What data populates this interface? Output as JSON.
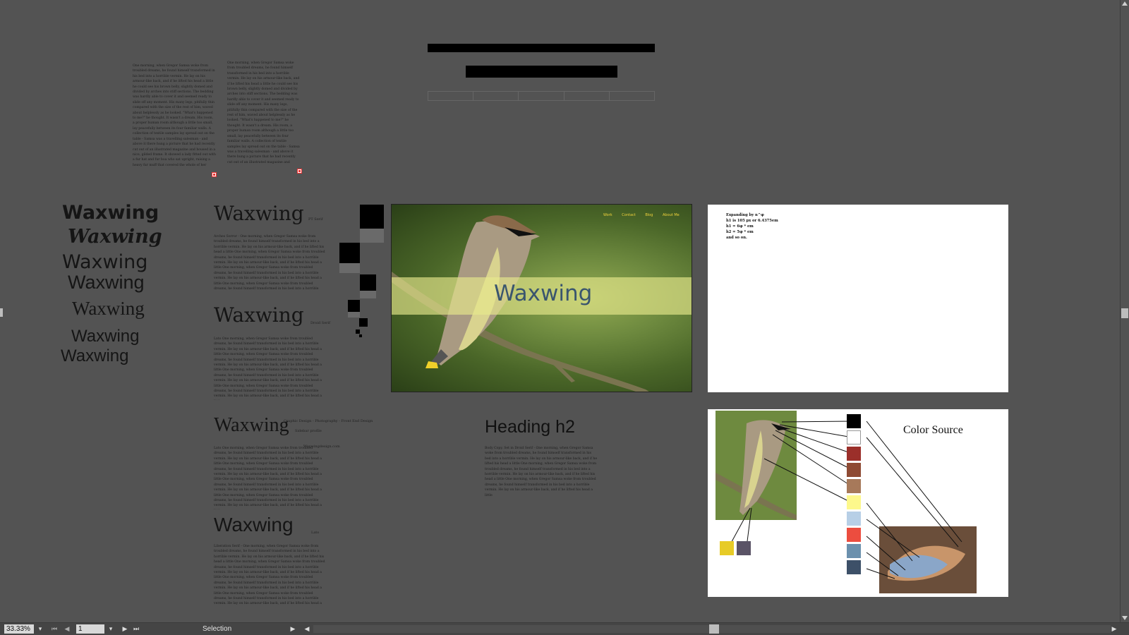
{
  "doc_text": {
    "para1": "One morning, when Gregor Samsa woke from troubled dreams, he found himself transformed in his bed into a horrible vermin. He lay on his armour-like back, and if he lifted his head a little he could see his brown belly, slightly domed and divided by arches into stiff sections. The bedding was hardly able to cover it and seemed ready to slide off any moment. His many legs, pitifully thin compared with the size of the rest of him, waved about helplessly as he looked. \"What's happened to me?\" he thought. It wasn't a dream. His room, a proper human room although a little too small, lay peacefully between its four familiar walls. A collection of textile samples lay spread out on the table - Samsa was a travelling salesman - and above it there hung a picture that he had recently cut out of an illustrated magazine and housed in a nice, gilded frame. It showed a lady fitted out with a fur hat and fur boa who sat upright, raising a heavy fur muff that covered the whole of her",
    "para2": "One morning, when Gregor Samsa woke from troubled dreams, he found himself transformed in his bed into a horrible vermin. He lay on his armour-like back, and if he lifted his head a little he could see his brown belly, slightly domed and divided by arches into stiff sections. The bedding was hardly able to cover it and seemed ready to slide off any moment. His many legs, pitifully thin compared with the size of the rest of him, waved about helplessly as he looked. \"What's happened to me?\" he thought. It wasn't a dream. His room, a proper human room although a little too small, lay peacefully between its four familiar walls. A collection of textile samples lay spread out on the table - Samsa was a travelling salesman - and above it there hung a picture that he had recently cut out of an illustrated magazine and"
  },
  "word_samples": [
    "Waxwing",
    "Waxwing",
    "Waxwing",
    "Waxwing",
    "Waxwing",
    "Waxwing",
    "Waxwing"
  ],
  "type_specimens": [
    {
      "title": "Waxwing",
      "font_label": "PT Serif",
      "body": "Arches Sorror - One morning, when Gregor Samsa woke from troubled dreams, he found himself transformed in his bed into a horrible vermin. He lay on his armour-like back, and if he lifted his head a little One morning, when Gregor Samsa woke from troubled dreams, he found himself transformed in his bed into a horrible vermin. He lay on his armour-like back, and if he lifted his head a little One morning, when Gregor Samsa woke from troubled dreams, he found himself transformed in his bed into a horrible vermin. He lay on his armour-like back, and if he lifted his head a little One morning, when Gregor Samsa woke from troubled dreams, he found himself transformed in his bed into a horrible vermin. He lay on his armour-like back, and if he lifted his head a little"
    },
    {
      "title": "Waxwing",
      "font_label": "Droid Serif",
      "body": "Lato One morning, when Gregor Samsa woke from troubled dreams, he found himself transformed in his bed into a horrible vermin. He lay on his armour-like back, and if he lifted his head a little One morning, when Gregor Samsa woke from troubled dreams, he found himself transformed in his bed into a horrible vermin. He lay on his armour-like back, and if he lifted his head a little One morning, when Gregor Samsa woke from troubled dreams, he found himself transformed in his bed into a horrible vermin. He lay on his armour-like back, and if he lifted his head a little One morning, when Gregor Samsa woke from troubled dreams, he found himself transformed in his bed into a horrible vermin. He lay on his armour-like back, and if he lifted his head a little"
    },
    {
      "title": "Waxwing",
      "font_label": "Graphic Design - Photography - Front End Design",
      "body": "Lato One morning, when Gregor Samsa woke from troubled dreams, he found himself transformed in his bed into a horrible vermin. He lay on his armour-like back, and if he lifted his head a little One morning, when Gregor Samsa woke from troubled dreams, he found himself transformed in his bed into a horrible vermin. He lay on his armour-like back, and if he lifted his head a little One morning, when Gregor Samsa woke from troubled dreams, he found himself transformed in his bed into a horrible vermin. He lay on his armour-like back, and if he lifted his head a little One morning, when Gregor Samsa woke from troubled dreams, he found himself transformed in his bed into a horrible vermin. He lay on his armour-like back, and if he lifted his head a little"
    },
    {
      "title": "Waxwing",
      "font_label": "Lato",
      "body": "Liberation Serif - One morning, when Gregor Samsa woke from troubled dreams, he found himself transformed in his bed into a horrible vermin. He lay on his armour-like back, and if he lifted his head a little One morning, when Gregor Samsa woke from troubled dreams, he found himself transformed in his bed into a horrible vermin. He lay on his armour-like back, and if he lifted his head a little One morning, when Gregor Samsa woke from troubled dreams, he found himself transformed in his bed into a horrible vermin. He lay on his armour-like back, and if he lifted his head a little One morning, when Gregor Samsa woke from troubled dreams, he found himself transformed in his bed into a horrible vermin. He lay on his armour-like back, and if he lifted his head a little"
    }
  ],
  "overlap_labels": [
    "Sidebar profile",
    "Waxwingdesign.com"
  ],
  "hero": {
    "nav": [
      "Work",
      "Contact",
      "Blog",
      "About Me"
    ],
    "title": "Waxwing",
    "nav_color": "#f0d23c",
    "band_color": "#e7e88c"
  },
  "scale_notes": {
    "lines": [
      "Expanding by n^φ",
      "h1 is 105 px or 6.4375em",
      "h1 = 6φ * em",
      "h2 = 5φ * em",
      "and so on."
    ]
  },
  "heading_sample": {
    "title": "Heading h2",
    "body": "Body Copy. Set in Droid Serif - One morning, when Gregor Samsa woke from troubled dreams, he found himself transformed in his bed into a horrible vermin. He lay on his armour-like back, and if he lifted his head a little One morning, when Gregor Samsa woke from troubled dreams, he found himself transformed in his bed into a horrible vermin. He lay on his armour-like back, and if he lifted his head a little One morning, when Gregor Samsa woke from troubled dreams, he found himself transformed in his bed into a horrible vermin. He lay on his armour-like back, and if he lifted his head a little"
  },
  "color_source": {
    "title": "Color Source",
    "swatches": [
      "#000000",
      "#ffffff",
      "#9b2f2a",
      "#8e4a33",
      "#a7795a",
      "#fdf88c",
      "#b7cfe6",
      "#ec4d3f",
      "#6b90ad",
      "#3d5068"
    ],
    "extra_swatches": [
      "#e7cb27",
      "#5a5366"
    ]
  },
  "statusbar": {
    "zoom": "33.33%",
    "page": "1",
    "tool": "Selection"
  }
}
